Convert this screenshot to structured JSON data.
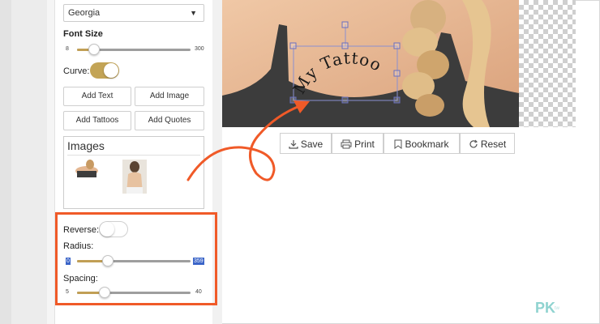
{
  "font": {
    "selected": "Georgia"
  },
  "font_size": {
    "label": "Font Size",
    "min": "8",
    "max": "300",
    "value_fraction": 0.15
  },
  "curve": {
    "label": "Curve:",
    "on": true
  },
  "buttons": {
    "add_text": "Add Text",
    "add_image": "Add Image",
    "add_tattoos": "Add Tattoos",
    "add_quotes": "Add Quotes"
  },
  "images": {
    "title": "Images"
  },
  "reverse": {
    "label": "Reverse:",
    "on": false
  },
  "radius": {
    "label": "Radius:",
    "min": "0",
    "max": "359",
    "value_fraction": 0.27
  },
  "spacing": {
    "label": "Spacing:",
    "min": "5",
    "max": "40",
    "value_fraction": 0.24
  },
  "canvas": {
    "text": "My Tattoo"
  },
  "toolbar": {
    "save": "Save",
    "print": "Print",
    "bookmark": "Bookmark",
    "reset": "Reset"
  },
  "watermark": {
    "brand": "PK",
    "sub": "tw"
  },
  "colors": {
    "accent": "#c3a456",
    "highlight": "#f05a28",
    "selection": "#8a8fd0",
    "value_box": "#3a64c8"
  },
  "icons": [
    "save-icon",
    "print-icon",
    "bookmark-icon",
    "reset-icon",
    "dropdown-caret-icon"
  ]
}
